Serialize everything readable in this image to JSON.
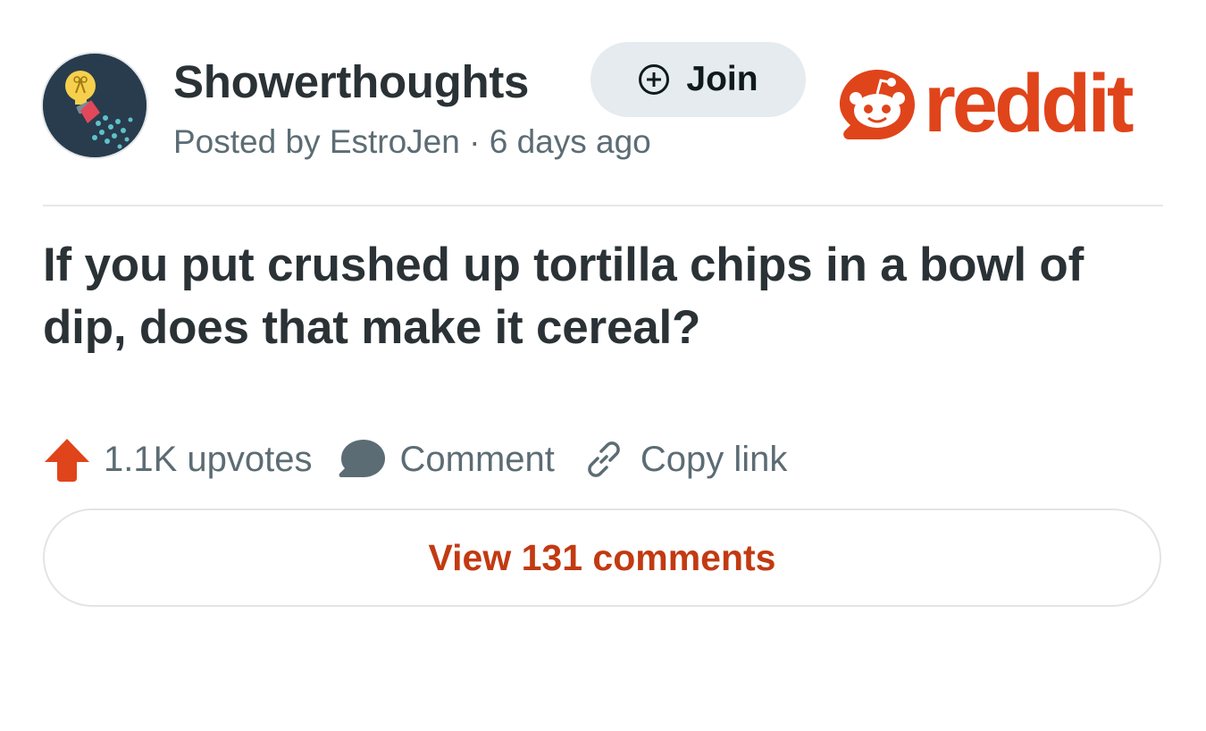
{
  "post": {
    "subreddit": "Showerthoughts",
    "posted_by": "Posted by EstroJen · 6 days ago",
    "title": "If you put crushed up tortilla chips in a bowl of dip, does that make it cereal?"
  },
  "join_button": {
    "label": "Join",
    "icon": "plus-circle-icon"
  },
  "brand": {
    "wordmark": "reddit",
    "color": "#e0441a"
  },
  "actions": {
    "upvotes": "1.1K upvotes",
    "comment": "Comment",
    "copy_link": "Copy link"
  },
  "view_comments": {
    "label": "View 131 comments"
  },
  "colors": {
    "text_primary": "#2a3236",
    "text_secondary": "#5c6c74",
    "upvote": "#e0441a",
    "link_accent": "#c23a12",
    "join_bg": "#e5ebee"
  }
}
